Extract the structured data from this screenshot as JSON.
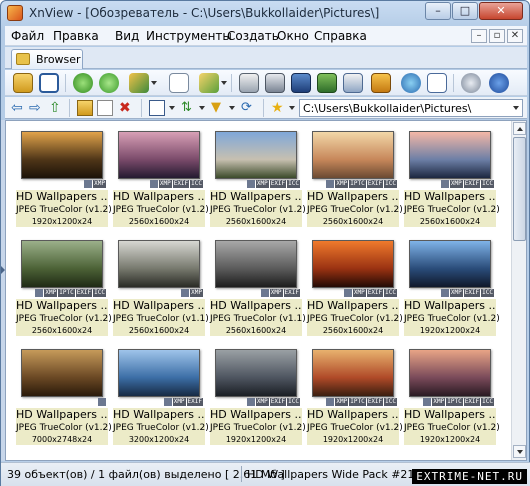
{
  "window": {
    "title": "XnView - [Обозреватель - C:\\Users\\Bukkollaider\\Pictures\\]",
    "controls": {
      "minimize": "–",
      "maximize": "□",
      "close": "✕"
    }
  },
  "menu": {
    "items": [
      "Файл",
      "Правка",
      "Вид",
      "Инструменты",
      "Создать",
      "Окно",
      "Справка"
    ],
    "mdi": [
      "–",
      "▫",
      "✕"
    ]
  },
  "tabs": [
    {
      "label": "Browser"
    }
  ],
  "toolbar": {
    "icons": [
      "open-folder-icon",
      "fullscreen-icon",
      "refresh-icon",
      "rotate-icon",
      "convert-icon",
      "info-icon",
      "filelist-icon",
      "print-icon",
      "scanner-icon",
      "filmstrip-icon",
      "slideshow-icon",
      "capture-icon",
      "screen-icon",
      "webpage-icon",
      "contact-sheet-icon",
      "settings-icon",
      "about-icon"
    ]
  },
  "address": {
    "path": "C:\\Users\\Bukkollaider\\Pictures\\"
  },
  "thumbnails": [
    {
      "name": "HD Wallpapers ...",
      "type": "JPEG TrueColor (v1.2)",
      "dims": "1920x1200x24",
      "badges": [
        "XMP"
      ],
      "colors": [
        "#e2a34b",
        "#4f3618",
        "#1b1208"
      ]
    },
    {
      "name": "HD Wallpapers ...",
      "type": "JPEG TrueColor (v1.2)",
      "dims": "2560x1600x24",
      "badges": [
        "XMP",
        "EXIF",
        "ICC"
      ],
      "colors": [
        "#d8a0b6",
        "#7a4a6a",
        "#241a30"
      ]
    },
    {
      "name": "HD Wallpapers ...",
      "type": "JPEG TrueColor (v1.2)",
      "dims": "2560x1600x24",
      "badges": [
        "XMP",
        "EXIF",
        "ICC"
      ],
      "colors": [
        "#7fa7d9",
        "#c7c0b0",
        "#3b4a2a"
      ]
    },
    {
      "name": "HD Wallpapers ...",
      "type": "JPEG TrueColor (v1.2)",
      "dims": "2560x1600x24",
      "badges": [
        "XMP",
        "IPTC",
        "EXIF",
        "ICC"
      ],
      "colors": [
        "#f2d7a8",
        "#c7875a",
        "#6b4a32"
      ]
    },
    {
      "name": "HD Wallpapers ...",
      "type": "JPEG TrueColor (v1.2)",
      "dims": "2560x1600x24",
      "badges": [
        "XMP",
        "EXIF",
        "ICC"
      ],
      "colors": [
        "#f4b7a6",
        "#6d7fa6",
        "#1c2740"
      ]
    },
    {
      "name": "HD Wallpapers ...",
      "type": "JPEG TrueColor (v1.2)",
      "dims": "2560x1600x24",
      "badges": [
        "XMP",
        "IPTC",
        "EXIF",
        "ICC"
      ],
      "colors": [
        "#9bb08a",
        "#4c6236",
        "#1f2a15"
      ]
    },
    {
      "name": "HD Wallpapers ...",
      "type": "JPEG TrueColor (v1.1)",
      "dims": "2560x1600x24",
      "badges": [
        "XMP"
      ],
      "colors": [
        "#d7d7d2",
        "#77796e",
        "#2a2b25"
      ]
    },
    {
      "name": "HD Wallpapers ...",
      "type": "JPEG TrueColor (v1.1)",
      "dims": "2560x1600x24",
      "badges": [
        "XMP",
        "EXIF"
      ],
      "colors": [
        "#a8a8a8",
        "#5b5b5b",
        "#1d1d1d"
      ]
    },
    {
      "name": "HD Wallpapers ...",
      "type": "JPEG TrueColor (v1.2)",
      "dims": "2560x1600x24",
      "badges": [
        "XMP",
        "EXIF",
        "ICC"
      ],
      "colors": [
        "#f07a2c",
        "#9a3212",
        "#220a05"
      ]
    },
    {
      "name": "HD Wallpapers ...",
      "type": "JPEG TrueColor (v1.2)",
      "dims": "1920x1200x24",
      "badges": [
        "XMP",
        "EXIF",
        "ICC"
      ],
      "colors": [
        "#7fb3e8",
        "#2a4c7a",
        "#10182a"
      ]
    },
    {
      "name": "HD Wallpapers ...",
      "type": "JPEG TrueColor (v1.2)",
      "dims": "7000x2748x24",
      "badges": [],
      "colors": [
        "#c69a5a",
        "#6a4824",
        "#2a1a0a"
      ]
    },
    {
      "name": "HD Wallpapers ...",
      "type": "JPEG TrueColor (v1.2)",
      "dims": "3200x1200x24",
      "badges": [
        "XMP",
        "EXIF"
      ],
      "colors": [
        "#9fc4ea",
        "#3c6ea6",
        "#172a44"
      ]
    },
    {
      "name": "HD Wallpapers ...",
      "type": "JPEG TrueColor (v1.2)",
      "dims": "1920x1200x24",
      "badges": [
        "XMP",
        "EXIF",
        "ICC"
      ],
      "colors": [
        "#9aa0a4",
        "#4e5560",
        "#1a1e24"
      ]
    },
    {
      "name": "HD Wallpapers ...",
      "type": "JPEG TrueColor (v1.2)",
      "dims": "1920x1200x24",
      "badges": [
        "XMP",
        "IPTC",
        "EXIF",
        "ICC"
      ],
      "colors": [
        "#e8b26e",
        "#b04a28",
        "#3a1e10"
      ]
    },
    {
      "name": "HD Wallpapers ...",
      "type": "JPEG TrueColor (v1.2)",
      "dims": "1920x1200x24",
      "badges": [
        "XMP",
        "IPTC",
        "EXIF",
        "ICC"
      ],
      "colors": [
        "#e8a486",
        "#7a4a5a",
        "#2a1a22"
      ]
    }
  ],
  "status": {
    "left": "39 объект(ов) / 1 файл(ов) выделено  [ 2.61 Мб ]",
    "right": "HD Wallpapers Wide Pack #21 (5).jpg  2560x1600x24 (1.6",
    "watermark": "EXTRIME-NET.RU"
  }
}
